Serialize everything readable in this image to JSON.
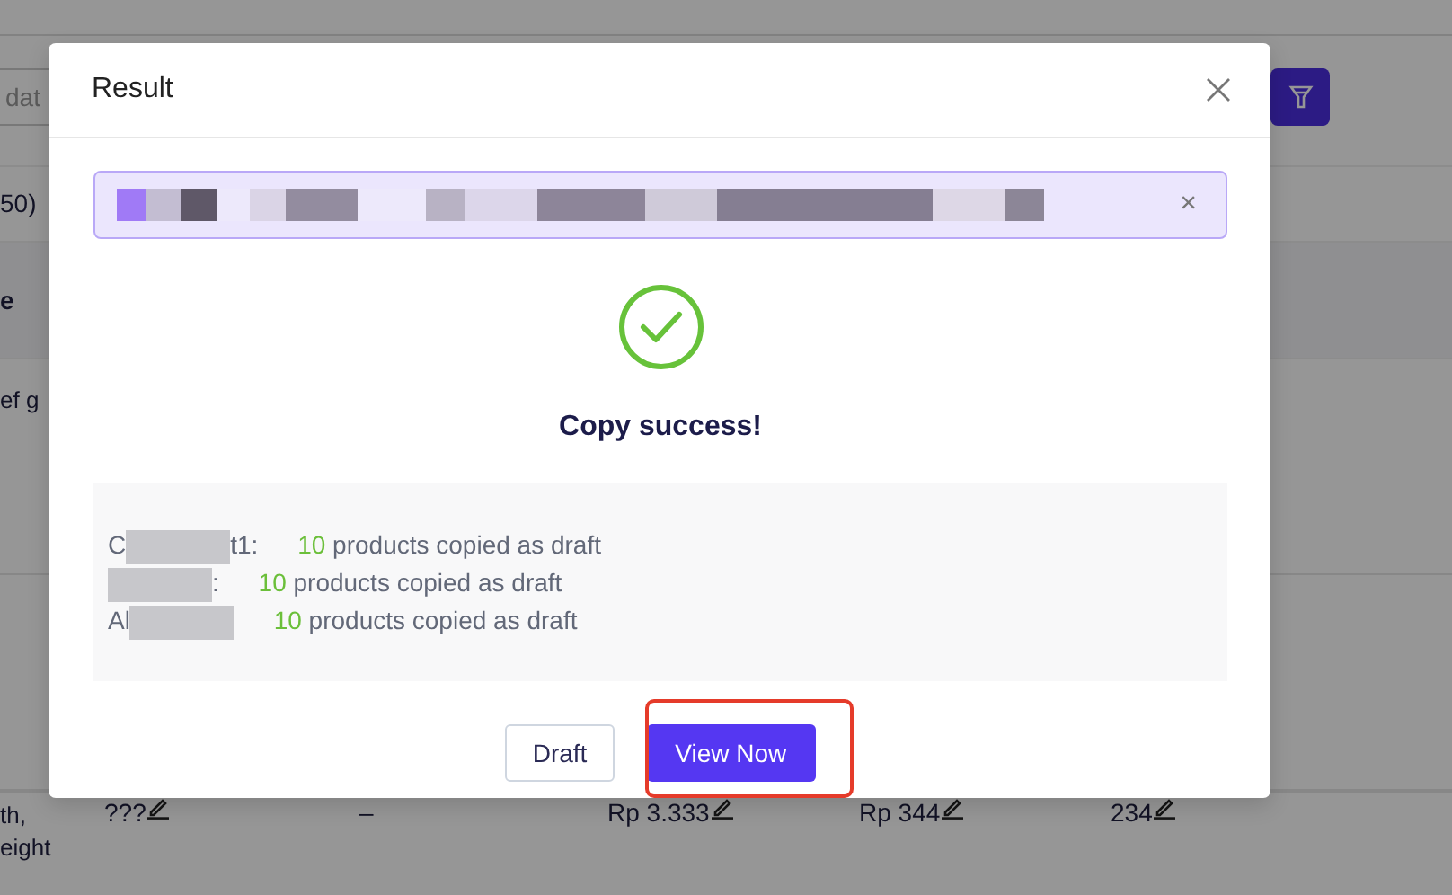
{
  "page": {
    "date_field": {
      "placeholder": "dat"
    },
    "count_text": "50)",
    "header_cell": "e",
    "rows": [
      {
        "name_lines": [
          "ef g"
        ]
      },
      {
        "name_lines": [
          "th,",
          "eight"
        ],
        "cells": [
          "???",
          "–",
          "Rp 3.333",
          "Rp 344",
          "234"
        ],
        "editable": [
          true,
          false,
          true,
          true,
          true
        ]
      }
    ]
  },
  "dialog": {
    "title": "Result",
    "alert": {
      "dismiss": "×"
    },
    "status": "Copy success!",
    "results": [
      {
        "label_start": "C",
        "label_end": "t1:",
        "count": "10",
        "text": "products copied as draft"
      },
      {
        "label_end": ":",
        "count": "10",
        "text": "products copied as draft"
      },
      {
        "label_start": "Al",
        "count": "10",
        "text": "products copied as draft"
      }
    ],
    "buttons": [
      {
        "label": "Draft",
        "kind": "secondary",
        "highlighted": false
      },
      {
        "label": "View Now",
        "kind": "primary",
        "highlighted": true
      }
    ]
  }
}
